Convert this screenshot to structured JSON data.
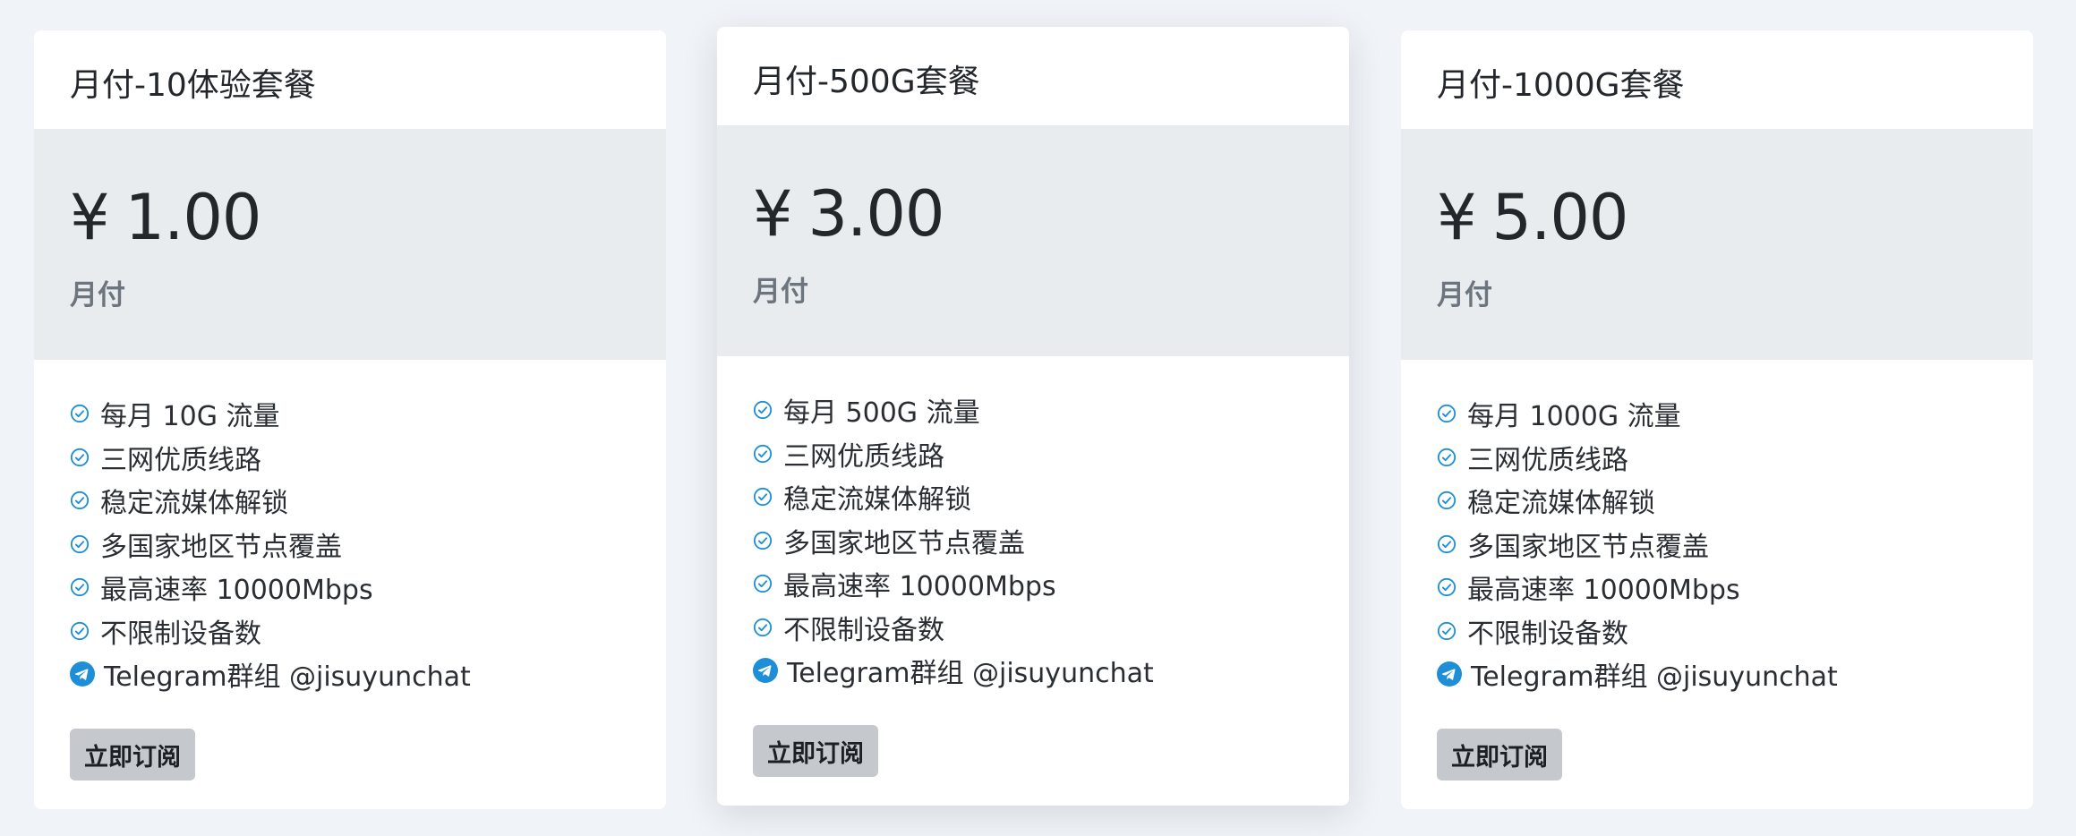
{
  "colors": {
    "page_bg": "#f0f3f7",
    "card_bg": "#ffffff",
    "price_bg": "#e9ecef",
    "check_icon": "#1e8fd6",
    "button_bg": "#c5c9cd"
  },
  "icons": {
    "feature": "check-circle-icon",
    "contact": "telegram-icon"
  },
  "plans": [
    {
      "title": "月付-10体验套餐",
      "currency": "¥",
      "price": "1.00",
      "period": "月付",
      "features": [
        "每月 10G 流量",
        "三网优质线路",
        "稳定流媒体解锁",
        "多国家地区节点覆盖",
        "最高速率 10000Mbps",
        "不限制设备数"
      ],
      "contact": "Telegram群组 @jisuyunchat",
      "button": "立即订阅"
    },
    {
      "title": "月付-500G套餐",
      "currency": "¥",
      "price": "3.00",
      "period": "月付",
      "features": [
        "每月 500G 流量",
        "三网优质线路",
        "稳定流媒体解锁",
        "多国家地区节点覆盖",
        "最高速率 10000Mbps",
        "不限制设备数"
      ],
      "contact": "Telegram群组 @jisuyunchat",
      "button": "立即订阅"
    },
    {
      "title": "月付-1000G套餐",
      "currency": "¥",
      "price": "5.00",
      "period": "月付",
      "features": [
        "每月 1000G 流量",
        "三网优质线路",
        "稳定流媒体解锁",
        "多国家地区节点覆盖",
        "最高速率 10000Mbps",
        "不限制设备数"
      ],
      "contact": "Telegram群组 @jisuyunchat",
      "button": "立即订阅"
    }
  ]
}
